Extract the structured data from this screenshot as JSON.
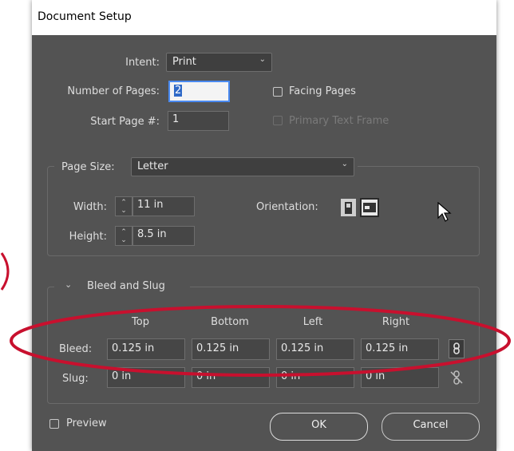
{
  "window": {
    "title": "Document Setup"
  },
  "intent": {
    "label": "Intent:",
    "value": "Print"
  },
  "pages": {
    "label": "Number of Pages:",
    "value": "2",
    "start_label": "Start Page #:",
    "start_value": "1"
  },
  "options": {
    "facing_pages": "Facing Pages",
    "primary_text_frame": "Primary Text Frame",
    "facing_checked": false
  },
  "page_size": {
    "label": "Page Size:",
    "value": "Letter",
    "width_label": "Width:",
    "width_value": "11 in",
    "height_label": "Height:",
    "height_value": "8.5 in",
    "orientation_label": "Orientation:"
  },
  "bleed_slug": {
    "section_label": "Bleed and Slug",
    "columns": [
      "Top",
      "Bottom",
      "Left",
      "Right"
    ],
    "bleed_label": "Bleed:",
    "bleed_values": [
      "0.125 in",
      "0.125 in",
      "0.125 in",
      "0.125 in"
    ],
    "slug_label": "Slug:",
    "slug_values": [
      "0 in",
      "0 in",
      "0 in",
      "0 in"
    ]
  },
  "footer": {
    "preview_label": "Preview",
    "ok_label": "OK",
    "cancel_label": "Cancel"
  },
  "colors": {
    "dialog_bg": "#535353",
    "highlight": "#c8102e",
    "selection": "#2f69c7"
  }
}
